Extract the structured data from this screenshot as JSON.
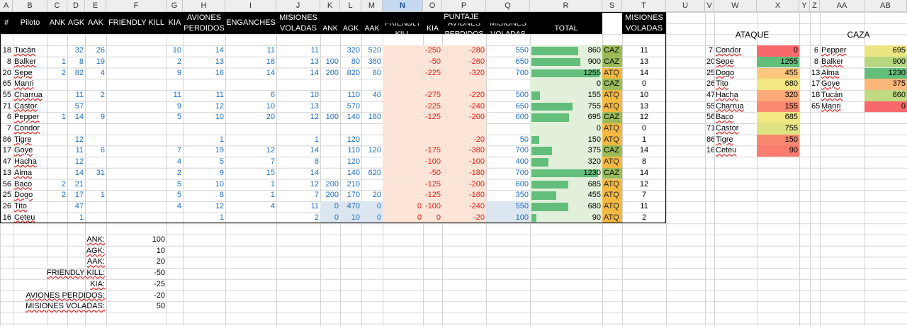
{
  "sheet": {
    "columns": [
      "A",
      "B",
      "C",
      "D",
      "E",
      "F",
      "G",
      "H",
      "I",
      "J",
      "K",
      "L",
      "M",
      "N",
      "O",
      "P",
      "Q",
      "R",
      "S",
      "T",
      "U",
      "V",
      "W",
      "X",
      "Y",
      "Z",
      "AA",
      "AB"
    ],
    "selected_column": "N",
    "header_row": {
      "hash": "#",
      "piloto": "Piloto",
      "ank": "ANK",
      "agk": "AGK",
      "aak": "AAK",
      "friendly_kill": "FRIENDLY KILL",
      "kia": "KIA",
      "aviones_perdidos": "AVIONES PERDIDOS",
      "enganches": "ENGANCHES",
      "misiones_voladas": "MISIONES VOLADAS",
      "puntaje": "PUNTAJE",
      "p_ank": "ANK",
      "p_agk": "AGK",
      "p_aak": "AAK",
      "p_friendly_kill": "FRIENDLY KILL",
      "p_kia": "KIA",
      "p_aviones_perdidos": "AVIONES PERDIDOS",
      "p_misiones_voladas": "MISIONES VOLADAS",
      "total": "TOTAL",
      "misiones_voladas_t": "MISIONES VOLADAS"
    },
    "pilots": [
      {
        "num": "18",
        "name": "Tucán",
        "ank": "",
        "agk": "32",
        "aak": "26",
        "fk": "",
        "kia": "10",
        "ap": "14",
        "eng": "11",
        "mv": "11",
        "p_ank": "",
        "p_agk": "320",
        "p_aak": "520",
        "p_fk": "",
        "p_kia": "-250",
        "p_ap": "-280",
        "p_mv": "550",
        "total": "860",
        "role": "CAZ",
        "misiones": "11"
      },
      {
        "num": "8",
        "name": "Balker",
        "ank": "1",
        "agk": "8",
        "aak": "19",
        "fk": "",
        "kia": "2",
        "ap": "13",
        "eng": "18",
        "mv": "13",
        "p_ank": "100",
        "p_agk": "80",
        "p_aak": "380",
        "p_fk": "",
        "p_kia": "-50",
        "p_ap": "-260",
        "p_mv": "650",
        "total": "900",
        "role": "CAZ",
        "misiones": "13"
      },
      {
        "num": "20",
        "name": "Sepe",
        "ank": "2",
        "agk": "82",
        "aak": "4",
        "fk": "",
        "kia": "9",
        "ap": "16",
        "eng": "14",
        "mv": "14",
        "p_ank": "200",
        "p_agk": "820",
        "p_aak": "80",
        "p_fk": "",
        "p_kia": "-225",
        "p_ap": "-320",
        "p_mv": "700",
        "total": "1255",
        "role": "ATQ",
        "misiones": "14"
      },
      {
        "num": "65",
        "name": "Manri",
        "ank": "",
        "agk": "",
        "aak": "",
        "fk": "",
        "kia": "",
        "ap": "",
        "eng": "",
        "mv": "",
        "p_ank": "",
        "p_agk": "",
        "p_aak": "",
        "p_fk": "",
        "p_kia": "",
        "p_ap": "",
        "p_mv": "",
        "total": "0",
        "role": "CAZ",
        "misiones": "0"
      },
      {
        "num": "55",
        "name": "Charrua",
        "ank": "",
        "agk": "11",
        "aak": "2",
        "fk": "",
        "kia": "11",
        "ap": "11",
        "eng": "6",
        "mv": "10",
        "p_ank": "",
        "p_agk": "110",
        "p_aak": "40",
        "p_fk": "",
        "p_kia": "-275",
        "p_ap": "-220",
        "p_mv": "500",
        "total": "155",
        "role": "ATQ",
        "misiones": "10"
      },
      {
        "num": "71",
        "name": "Castor",
        "ank": "",
        "agk": "57",
        "aak": "",
        "fk": "",
        "kia": "9",
        "ap": "12",
        "eng": "10",
        "mv": "13",
        "p_ank": "",
        "p_agk": "570",
        "p_aak": "",
        "p_fk": "",
        "p_kia": "-225",
        "p_ap": "-240",
        "p_mv": "650",
        "total": "755",
        "role": "ATQ",
        "misiones": "13"
      },
      {
        "num": "6",
        "name": "Pepper",
        "ank": "1",
        "agk": "14",
        "aak": "9",
        "fk": "",
        "kia": "5",
        "ap": "10",
        "eng": "20",
        "mv": "12",
        "p_ank": "100",
        "p_agk": "140",
        "p_aak": "180",
        "p_fk": "",
        "p_kia": "-125",
        "p_ap": "-200",
        "p_mv": "600",
        "total": "695",
        "role": "CAZ",
        "misiones": "12"
      },
      {
        "num": "7",
        "name": "Condor",
        "ank": "",
        "agk": "",
        "aak": "",
        "fk": "",
        "kia": "",
        "ap": "",
        "eng": "",
        "mv": "",
        "p_ank": "",
        "p_agk": "",
        "p_aak": "",
        "p_fk": "",
        "p_kia": "",
        "p_ap": "",
        "p_mv": "",
        "total": "0",
        "role": "ATQ",
        "misiones": "0"
      },
      {
        "num": "86",
        "name": "Tigre",
        "ank": "",
        "agk": "12",
        "aak": "",
        "fk": "",
        "kia": "",
        "ap": "1",
        "eng": "",
        "mv": "1",
        "p_ank": "",
        "p_agk": "120",
        "p_aak": "",
        "p_fk": "",
        "p_kia": "",
        "p_ap": "-20",
        "p_mv": "50",
        "total": "150",
        "role": "ATQ",
        "misiones": "1"
      },
      {
        "num": "17",
        "name": "Goye",
        "ank": "",
        "agk": "11",
        "aak": "6",
        "fk": "",
        "kia": "7",
        "ap": "19",
        "eng": "12",
        "mv": "14",
        "p_ank": "",
        "p_agk": "110",
        "p_aak": "120",
        "p_fk": "",
        "p_kia": "-175",
        "p_ap": "-380",
        "p_mv": "700",
        "total": "375",
        "role": "CAZ",
        "misiones": "14"
      },
      {
        "num": "47",
        "name": "Hacha",
        "ank": "",
        "agk": "12",
        "aak": "",
        "fk": "",
        "kia": "4",
        "ap": "5",
        "eng": "7",
        "mv": "8",
        "p_ank": "",
        "p_agk": "120",
        "p_aak": "",
        "p_fk": "",
        "p_kia": "-100",
        "p_ap": "-100",
        "p_mv": "400",
        "total": "320",
        "role": "ATQ",
        "misiones": "8"
      },
      {
        "num": "13",
        "name": "Alma",
        "ank": "",
        "agk": "14",
        "aak": "31",
        "fk": "",
        "kia": "2",
        "ap": "9",
        "eng": "15",
        "mv": "14",
        "p_ank": "",
        "p_agk": "140",
        "p_aak": "620",
        "p_fk": "",
        "p_kia": "-50",
        "p_ap": "-180",
        "p_mv": "700",
        "total": "1230",
        "role": "CAZ",
        "misiones": "14"
      },
      {
        "num": "56",
        "name": "Baco",
        "ank": "2",
        "agk": "21",
        "aak": "",
        "fk": "",
        "kia": "5",
        "ap": "10",
        "eng": "1",
        "mv": "12",
        "p_ank": "200",
        "p_agk": "210",
        "p_aak": "",
        "p_fk": "",
        "p_kia": "-125",
        "p_ap": "-200",
        "p_mv": "600",
        "total": "685",
        "role": "ATQ",
        "misiones": "12"
      },
      {
        "num": "25",
        "name": "Dogo",
        "ank": "2",
        "agk": "17",
        "aak": "1",
        "fk": "",
        "kia": "5",
        "ap": "8",
        "eng": "1",
        "mv": "7",
        "p_ank": "200",
        "p_agk": "170",
        "p_aak": "20",
        "p_fk": "",
        "p_kia": "-125",
        "p_ap": "-160",
        "p_mv": "350",
        "total": "455",
        "role": "ATQ",
        "misiones": "7"
      },
      {
        "num": "26",
        "name": "Tito",
        "ank": "",
        "agk": "47",
        "aak": "",
        "fk": "",
        "kia": "4",
        "ap": "12",
        "eng": "4",
        "mv": "11",
        "p_ank": "0",
        "p_agk": "470",
        "p_aak": "0",
        "p_fk": "0",
        "p_kia": "-100",
        "p_ap": "-240",
        "p_mv": "550",
        "total": "680",
        "role": "ATQ",
        "misiones": "11"
      },
      {
        "num": "16",
        "name": "Ceteu",
        "ank": "",
        "agk": "1",
        "aak": "",
        "fk": "",
        "kia": "",
        "ap": "1",
        "eng": "",
        "mv": "2",
        "p_ank": "0",
        "p_agk": "10",
        "p_aak": "0",
        "p_fk": "0",
        "p_kia": "0",
        "p_ap": "-20",
        "p_mv": "100",
        "total": "90",
        "role": "ATQ",
        "misiones": "2"
      }
    ],
    "ataque": {
      "title": "ATAQUE",
      "rows": [
        {
          "num": "7",
          "name": "Condor",
          "total": "0"
        },
        {
          "num": "20",
          "name": "Sepe",
          "total": "1255"
        },
        {
          "num": "25",
          "name": "Dogo",
          "total": "455"
        },
        {
          "num": "26",
          "name": "Tito",
          "total": "680"
        },
        {
          "num": "47",
          "name": "Hacha",
          "total": "320"
        },
        {
          "num": "55",
          "name": "Charrua",
          "total": "155"
        },
        {
          "num": "56",
          "name": "Baco",
          "total": "685"
        },
        {
          "num": "71",
          "name": "Castor",
          "total": "755"
        },
        {
          "num": "86",
          "name": "Tigre",
          "total": "150"
        },
        {
          "num": "16",
          "name": "Ceteu",
          "total": "90"
        }
      ]
    },
    "caza": {
      "title": "CAZA",
      "rows": [
        {
          "num": "6",
          "name": "Pepper",
          "total": "695"
        },
        {
          "num": "8",
          "name": "Balker",
          "total": "900"
        },
        {
          "num": "13",
          "name": "Alma",
          "total": "1230"
        },
        {
          "num": "17",
          "name": "Goye",
          "total": "375"
        },
        {
          "num": "18",
          "name": "Tucán",
          "total": "860"
        },
        {
          "num": "65",
          "name": "Manri",
          "total": "0"
        }
      ]
    },
    "scoring": [
      {
        "label": "ANK:",
        "value": "100"
      },
      {
        "label": "AGK:",
        "value": "10"
      },
      {
        "label": "AAK:",
        "value": "20"
      },
      {
        "label": "FRIENDLY KILL:",
        "value": "-50"
      },
      {
        "label": "KIA:",
        "value": "-25"
      },
      {
        "label": "AVIONES PERDIDOS:",
        "value": "-20"
      },
      {
        "label": "MISIONES VOLADAS:",
        "value": "50"
      }
    ],
    "colors": {
      "grid": "#d4d4d4",
      "header_black": "#000000",
      "total_bar": "#63be7b",
      "total_bg": "#e2efda",
      "penalty_bg": "#fce4d6",
      "mv_blue_bg": "#dce6f1",
      "caz_bg": "#9bbb59",
      "atq_bg": "#f4b942",
      "scale_red": "#f8696b",
      "scale_yellow": "#ffeb84",
      "scale_green": "#63be7b"
    }
  }
}
